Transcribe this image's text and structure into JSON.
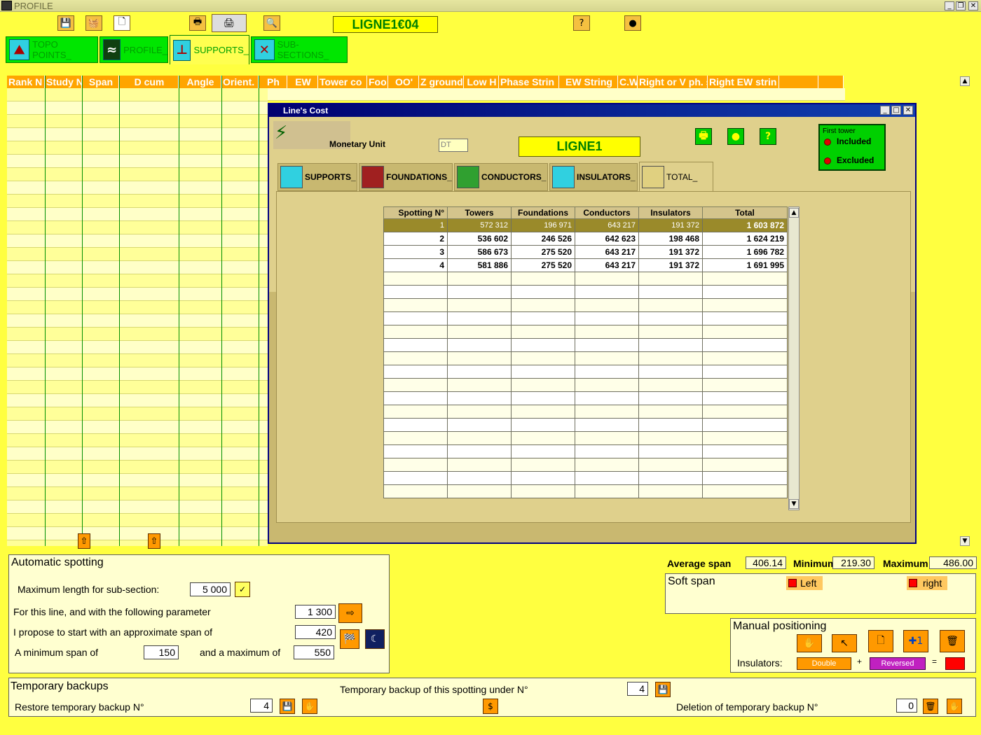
{
  "window": {
    "title": "PROFILE"
  },
  "toolbar": {
    "line_title": "LIGNE1€04",
    "icons": [
      "save-icon",
      "basket-icon",
      "new-document-icon",
      "printer-icon",
      "large-printer-icon",
      "zoom-icon",
      "help-icon",
      "exit-icon"
    ]
  },
  "main_tabs": [
    {
      "label": "TOPO POINTS_"
    },
    {
      "label": "PROFILE_"
    },
    {
      "label": "SUPPORTS_"
    },
    {
      "label": "SUB-SECTIONS_"
    }
  ],
  "grid": {
    "columns": [
      "Rank N",
      "Study N",
      "Span",
      "D cum",
      "Angle",
      "Orient.",
      "Ph",
      "EW",
      "Tower co",
      "Foo",
      "OO'",
      "Z ground",
      "Low H",
      "Phase Strin",
      "EW String",
      "C.W",
      "Right or V ph. s",
      "Right EW strin",
      "",
      ""
    ]
  },
  "dialog": {
    "title": "Line's Cost",
    "monetary_unit_label": "Monetary Unit",
    "monetary_unit_value": "DT",
    "line_name": "LIGNE1",
    "first_tower": {
      "title": "First tower",
      "included": "Included",
      "excluded": "Excluded"
    },
    "tabs": [
      {
        "label": "SUPPORTS_"
      },
      {
        "label": "FOUNDATIONS_"
      },
      {
        "label": "CONDUCTORS_"
      },
      {
        "label": "INSULATORS_"
      },
      {
        "label": "TOTAL_"
      }
    ],
    "table": {
      "headers": [
        "Spotting N°",
        "Towers",
        "Foundations",
        "Conductors",
        "Insulators",
        "Total"
      ],
      "rows": [
        [
          "1",
          "572 312",
          "196 971",
          "643 217",
          "191 372",
          "1 603 872"
        ],
        [
          "2",
          "536 602",
          "246 526",
          "642 623",
          "198 468",
          "1 624 219"
        ],
        [
          "3",
          "586 673",
          "275 520",
          "643 217",
          "191 372",
          "1 696 782"
        ],
        [
          "4",
          "581 886",
          "275 520",
          "643 217",
          "191 372",
          "1 691 995"
        ]
      ],
      "selected_row": 0
    }
  },
  "auto_spotting": {
    "title": "Automatic spotting",
    "max_length_label": "Maximum length for sub-section:",
    "max_length_value": "5 000",
    "param_label": "For this line, and with the following parameter",
    "param_value": "1 300",
    "approx_span_label": "I propose to start with an approximate span of",
    "approx_span_value": "420",
    "min_span_label": "A minimum span of",
    "min_span_value": "150",
    "max_span_label": "and a maximum of",
    "max_span_value": "550"
  },
  "stats": {
    "average_label": "Average span",
    "average_value": "406.14",
    "minimum_label": "Minimum",
    "minimum_value": "219.30",
    "maximum_label": "Maximum",
    "maximum_value": "486.00"
  },
  "soft_span": {
    "title": "Soft span",
    "left": "Left",
    "right": "right"
  },
  "manual": {
    "title": "Manual positioning",
    "insulators_label": "Insulators:",
    "double": "Double",
    "plus": "+",
    "reversed": "Reversed",
    "equals": "="
  },
  "backups": {
    "title": "Temporary backups",
    "save_label": "Temporary backup of this spotting under N°",
    "save_value": "4",
    "restore_label": "Restore temporary backup N°",
    "restore_value": "4",
    "delete_label": "Deletion of temporary backup N°",
    "delete_value": "0"
  }
}
